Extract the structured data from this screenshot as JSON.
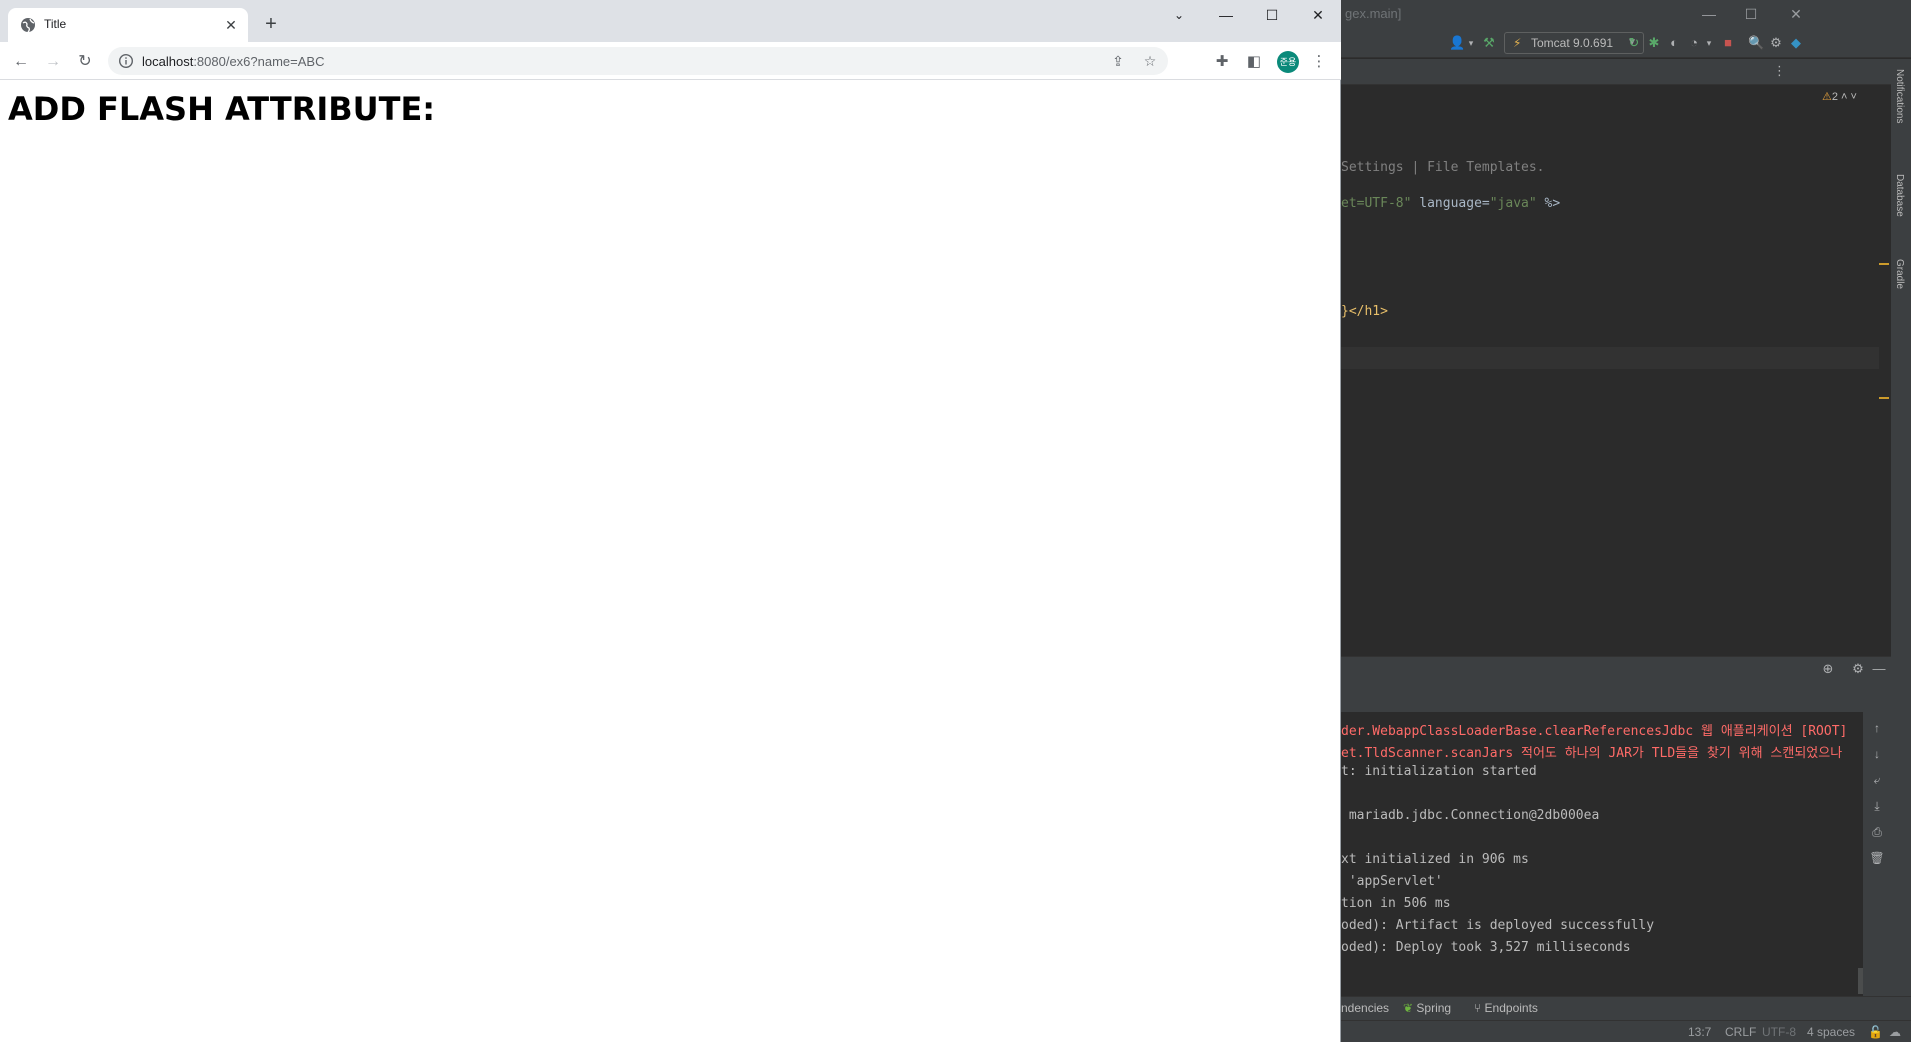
{
  "ide": {
    "title_fragment": "gex.main]",
    "run_config": "Tomcat 9.0.691",
    "warnings": "2",
    "editor_lines": [
      {
        "text": "Settings | File Templates.",
        "kind": "cmt"
      },
      {
        "text": "et=UTF-8\" language=\"java\" %>",
        "kind": "mixed"
      },
      {
        "text": "}</h1>",
        "kind": "tag"
      }
    ],
    "sidebar_tabs": [
      "Notifications",
      "Database",
      "Gradle"
    ],
    "console_lines": [
      {
        "text": "der.WebappClassLoaderBase.clearReferencesJdbc 웹 애플리케이션 [ROOT]",
        "kind": "err"
      },
      {
        "text": "et.TldScanner.scanJars 적어도 하나의 JAR가 TLD들을 찾기 위해 스캔되었으나",
        "kind": "err"
      },
      {
        "text": "t: initialization started",
        "kind": "norm"
      },
      {
        "text": "",
        "kind": "norm"
      },
      {
        "text": " mariadb.jdbc.Connection@2db000ea",
        "kind": "norm"
      },
      {
        "text": "",
        "kind": "norm"
      },
      {
        "text": "xt initialized in 906 ms",
        "kind": "norm"
      },
      {
        "text": " 'appServlet'",
        "kind": "norm"
      },
      {
        "text": "tion in 506 ms",
        "kind": "norm"
      },
      {
        "text": "oded): Artifact is deployed successfully",
        "kind": "norm"
      },
      {
        "text": "oded): Deploy took 3,527 milliseconds",
        "kind": "norm"
      }
    ],
    "tool_tabs": [
      "ndencies",
      "Spring",
      "Endpoints"
    ],
    "status": {
      "position": "13:7",
      "line_sep": "CRLF",
      "encoding": "UTF-8",
      "indent": "4 spaces"
    }
  },
  "chrome": {
    "tab_title": "Title",
    "url_host": "localhost",
    "url_path": ":8080/ex6?name=ABC",
    "avatar_text": "준용",
    "avatar_color": "#0b8a7a"
  },
  "page": {
    "heading": "ADD FLASH ATTRIBUTE:"
  }
}
